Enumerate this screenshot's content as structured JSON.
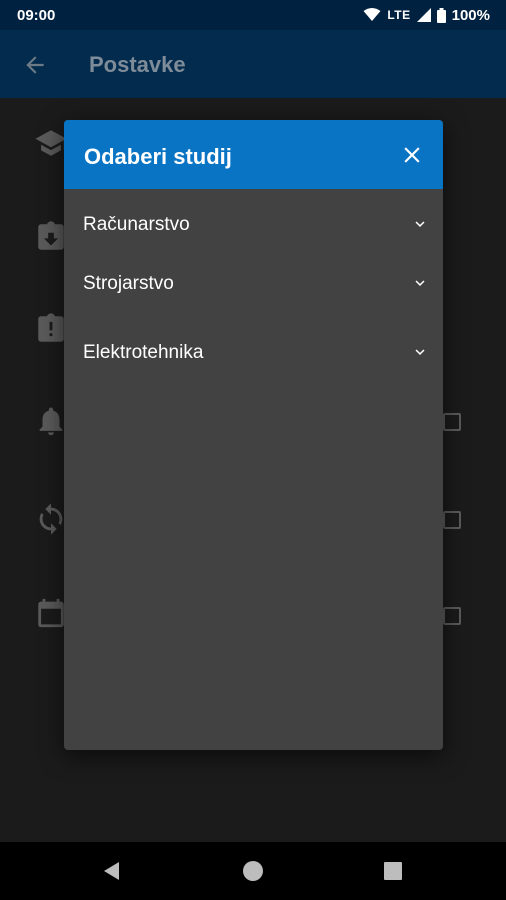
{
  "status_bar": {
    "time": "09:00",
    "network": "LTE",
    "battery": "100%",
    "icons": [
      "wifi-icon",
      "signal-icon",
      "battery-icon"
    ]
  },
  "app_bar": {
    "title": "Postavke",
    "back_icon": "arrow-left-icon"
  },
  "settings_bg": {
    "icons": [
      "graduation-cap-icon",
      "download-icon",
      "alert-clipboard-icon",
      "bell-icon",
      "sync-icon",
      "calendar-icon"
    ]
  },
  "dialog": {
    "title": "Odaberi studij",
    "close_icon": "close-icon",
    "items": [
      {
        "label": "Računarstvo"
      },
      {
        "label": "Strojarstvo"
      },
      {
        "label": "Elektrotehnika"
      }
    ]
  },
  "nav_bar": {
    "icons": [
      "back-triangle-icon",
      "home-circle-icon",
      "recents-square-icon"
    ]
  },
  "colors": {
    "status_bar": "#00213f",
    "app_bar": "#022b4d",
    "dialog_header": "#0a74c4",
    "dialog_body": "#424242"
  }
}
